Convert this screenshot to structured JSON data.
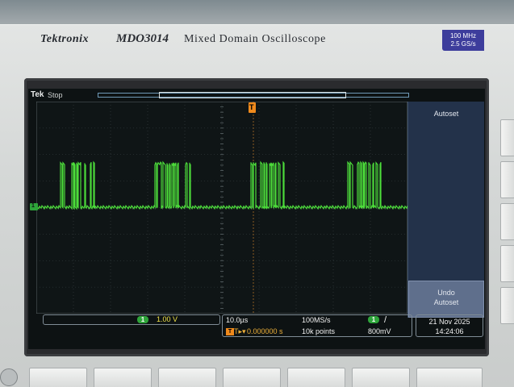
{
  "brand": {
    "name": "Tektronix",
    "model": "MDO3014",
    "description": "Mixed Domain Oscilloscope"
  },
  "spec_badge": {
    "bandwidth": "100 MHz",
    "sample_rate": "2.5 GS/s"
  },
  "status": {
    "brand_short": "Tek",
    "acquisition": "Stop",
    "trigger_marker": "T"
  },
  "side_menu": {
    "top_label": "Autoset",
    "bottom_line1": "Undo",
    "bottom_line2": "Autoset"
  },
  "channel1": {
    "badge": "1",
    "scale": "1.00 V",
    "ground_marker": "1"
  },
  "horizontal": {
    "time_per_div": "10.0µs",
    "sample_rate": "100MS/s",
    "record_length": "10k points",
    "delay_prefix": "T▸▾",
    "delay": "0.000000 s",
    "trigger_source_badge": "1",
    "trigger_slope": "/",
    "trigger_level": "800mV"
  },
  "datetime": {
    "date": "21 Nov 2025",
    "time": "14:24:06"
  },
  "colors": {
    "trace": "#4cdc3a",
    "menu_bg": "#23324a",
    "trigger_orange": "#f08a1c",
    "ch1": "#f0e24a"
  }
}
